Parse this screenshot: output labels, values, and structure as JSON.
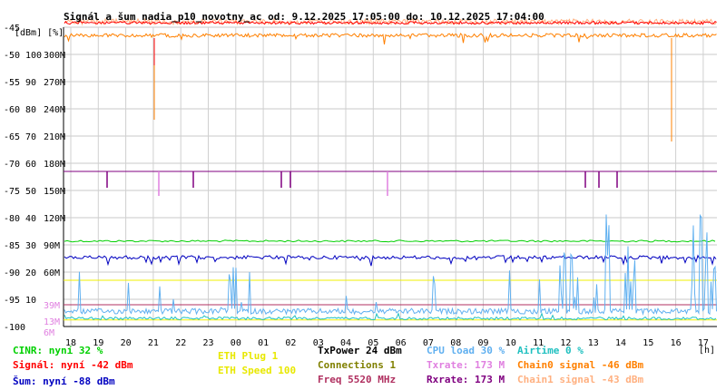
{
  "title": "Signál a šum nadia_p10_novotny_ac od: 9.12.2025 17:05:00 do: 10.12.2025 17:04:00",
  "unit_label": "[dBm] [%]",
  "x_unit": "[h]",
  "chart_data": {
    "type": "line",
    "title": "Signál a šum nadia_p10_novotny_ac od: 9.12.2025 17:05:00 do: 10.12.2025 17:04:00",
    "x_ticks": [
      "18",
      "19",
      "20",
      "21",
      "22",
      "23",
      "00",
      "01",
      "02",
      "03",
      "04",
      "05",
      "06",
      "07",
      "08",
      "09",
      "10",
      "11",
      "12",
      "13",
      "14",
      "15",
      "16",
      "17"
    ],
    "y_ticks_dbm": [
      "-45",
      "-50",
      "-55",
      "-60",
      "-65",
      "-70",
      "-75",
      "-80",
      "-85",
      "-90",
      "-95",
      "-100"
    ],
    "y_ticks_pct": [
      "100",
      "90",
      "80",
      "70",
      "60",
      "50",
      "40",
      "30",
      "20",
      "10"
    ],
    "y_ticks_rate": [
      "300M",
      "270M",
      "240M",
      "210M",
      "180M",
      "150M",
      "120M",
      "90M",
      "60M",
      "39M",
      "13M",
      "6M"
    ],
    "ylim_dbm": [
      -100,
      -45
    ],
    "grid": true,
    "series": [
      {
        "name": "Signál",
        "color": "#ff0000",
        "level": -42
      },
      {
        "name": "Chain0 signal",
        "color": "#ff8000",
        "level": -46
      },
      {
        "name": "Chain1 signal",
        "color": "#ffb080",
        "level": -43
      },
      {
        "name": "TxPower",
        "color": "#000000",
        "level": 24
      },
      {
        "name": "Freq",
        "color": "#b03060",
        "level": 5520
      },
      {
        "name": "Rxrate",
        "color": "#800080",
        "level": 173
      },
      {
        "name": "Šum",
        "color": "#0000c0",
        "level": -88
      },
      {
        "name": "CINR",
        "color": "#00e000",
        "level": 32
      },
      {
        "name": "ETH Speed",
        "color": "#f0f000",
        "level": 100
      },
      {
        "name": "CPU load",
        "color": "#60b0f0",
        "level": 30
      },
      {
        "name": "Airtime",
        "color": "#20c0c0",
        "level": 0
      }
    ]
  },
  "legend": {
    "cinr": "CINR: nyní 32 %",
    "signal": "Signál: nyní -42 dBm",
    "sum": "Šum: nyní -88 dBm",
    "eth_plug": "ETH Plug 1",
    "eth_speed": "ETH Speed 100",
    "txpower": "TxPower 24 dBm",
    "connections": "Connections 1",
    "freq": "Freq 5520 MHz",
    "cpu": "CPU load 30 %",
    "txrate": "Txrate: 173 M",
    "rxrate": "Rxrate: 173 M",
    "airtime": "Airtime 0 %",
    "chain0": "Chain0 signal -46 dBm",
    "chain1": "Chain1 signal -43 dBm"
  },
  "colors": {
    "cinr": "#00d000",
    "signal": "#ff0000",
    "sum": "#0000c0",
    "eth": "#f0f000",
    "txpower": "#000000",
    "connections": "#808000",
    "freq": "#b03060",
    "cpu": "#60b0f0",
    "txrate": "#e080e0",
    "rxrate": "#800080",
    "airtime": "#20c0c0",
    "chain0": "#ff8000",
    "chain1": "#ffb080"
  }
}
